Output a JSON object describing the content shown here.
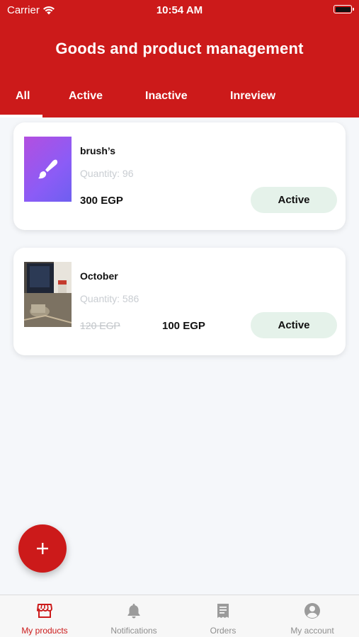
{
  "status_bar": {
    "carrier": "Carrier",
    "time": "10:54 AM"
  },
  "header": {
    "title": "Goods and product management"
  },
  "tabs": [
    {
      "label": "All",
      "active": true
    },
    {
      "label": "Active",
      "active": false
    },
    {
      "label": "Inactive",
      "active": false
    },
    {
      "label": "Inreview",
      "active": false
    }
  ],
  "products": [
    {
      "name": "brush’s",
      "quantity": "Quantity: 96",
      "price": "300 EGP",
      "status": "Active",
      "image_icon": "brush-icon"
    },
    {
      "name": "October",
      "quantity": "Quantity: 586",
      "old_price": "120 EGP",
      "price": "100 EGP",
      "status": "Active",
      "image_icon": "photo"
    }
  ],
  "fab": {
    "icon": "plus-icon"
  },
  "bottom_nav": [
    {
      "label": "My products",
      "icon": "store-icon",
      "active": true
    },
    {
      "label": "Notifications",
      "icon": "bell-icon",
      "active": false
    },
    {
      "label": "Orders",
      "icon": "receipt-icon",
      "active": false
    },
    {
      "label": "My account",
      "icon": "account-icon",
      "active": false
    }
  ],
  "colors": {
    "brand_red": "#cc1a1a",
    "pill_green": "#e5f2ea",
    "background": "#f5f7fa"
  }
}
